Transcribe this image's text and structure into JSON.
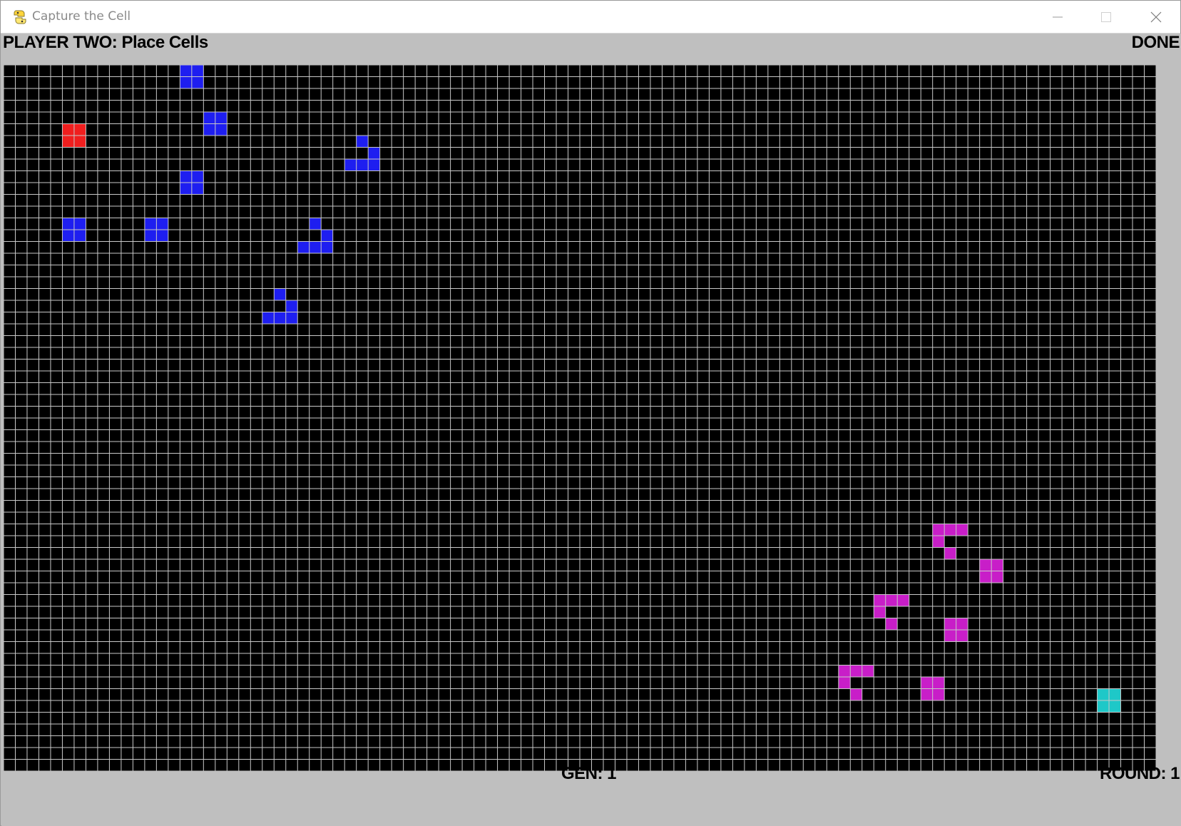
{
  "window": {
    "title": "Capture the Cell",
    "app_icon": "python-snake-icon",
    "controls": [
      "minimize-icon",
      "maximize-icon",
      "close-icon"
    ]
  },
  "hud": {
    "status_text": "PLAYER TWO:  Place Cells",
    "done_label": "DONE",
    "generation_label": "GEN: 1",
    "round_label": "ROUND: 1"
  },
  "board": {
    "columns": 98,
    "rows": 60,
    "background_color": "#000000",
    "grid_line_color": "#c8c8c8",
    "player_one_color": "#1e1ef0",
    "player_two_color": "#c81ec8",
    "player_one_base_color": "#f01e1e",
    "player_two_base_color": "#1ec8c8",
    "player_one_cells": [
      [
        15,
        0
      ],
      [
        16,
        0
      ],
      [
        15,
        1
      ],
      [
        16,
        1
      ],
      [
        17,
        4
      ],
      [
        18,
        4
      ],
      [
        17,
        5
      ],
      [
        18,
        5
      ],
      [
        5,
        5
      ],
      [
        6,
        5
      ],
      [
        5,
        6
      ],
      [
        6,
        6
      ],
      [
        30,
        6
      ],
      [
        31,
        7
      ],
      [
        29,
        8
      ],
      [
        30,
        8
      ],
      [
        31,
        8
      ],
      [
        15,
        9
      ],
      [
        16,
        9
      ],
      [
        15,
        10
      ],
      [
        16,
        10
      ],
      [
        5,
        13
      ],
      [
        6,
        13
      ],
      [
        5,
        14
      ],
      [
        6,
        14
      ],
      [
        12,
        13
      ],
      [
        13,
        13
      ],
      [
        12,
        14
      ],
      [
        13,
        14
      ],
      [
        26,
        13
      ],
      [
        27,
        14
      ],
      [
        25,
        15
      ],
      [
        26,
        15
      ],
      [
        27,
        15
      ],
      [
        23,
        19
      ],
      [
        24,
        20
      ],
      [
        22,
        21
      ],
      [
        23,
        21
      ],
      [
        24,
        21
      ]
    ],
    "player_one_base_cells": [
      [
        5,
        5
      ],
      [
        6,
        5
      ],
      [
        5,
        6
      ],
      [
        6,
        6
      ]
    ],
    "player_two_cells": [
      [
        79,
        39
      ],
      [
        80,
        39
      ],
      [
        81,
        39
      ],
      [
        79,
        40
      ],
      [
        80,
        41
      ],
      [
        83,
        42
      ],
      [
        84,
        42
      ],
      [
        83,
        43
      ],
      [
        84,
        43
      ],
      [
        74,
        45
      ],
      [
        75,
        45
      ],
      [
        76,
        45
      ],
      [
        74,
        46
      ],
      [
        75,
        47
      ],
      [
        80,
        47
      ],
      [
        81,
        47
      ],
      [
        80,
        48
      ],
      [
        81,
        48
      ],
      [
        71,
        51
      ],
      [
        72,
        51
      ],
      [
        73,
        51
      ],
      [
        71,
        52
      ],
      [
        72,
        53
      ],
      [
        78,
        52
      ],
      [
        79,
        52
      ],
      [
        78,
        53
      ],
      [
        79,
        53
      ],
      [
        93,
        53
      ],
      [
        94,
        53
      ],
      [
        93,
        54
      ],
      [
        94,
        54
      ]
    ],
    "player_two_base_cells": [
      [
        93,
        53
      ],
      [
        94,
        53
      ],
      [
        93,
        54
      ],
      [
        94,
        54
      ]
    ]
  }
}
